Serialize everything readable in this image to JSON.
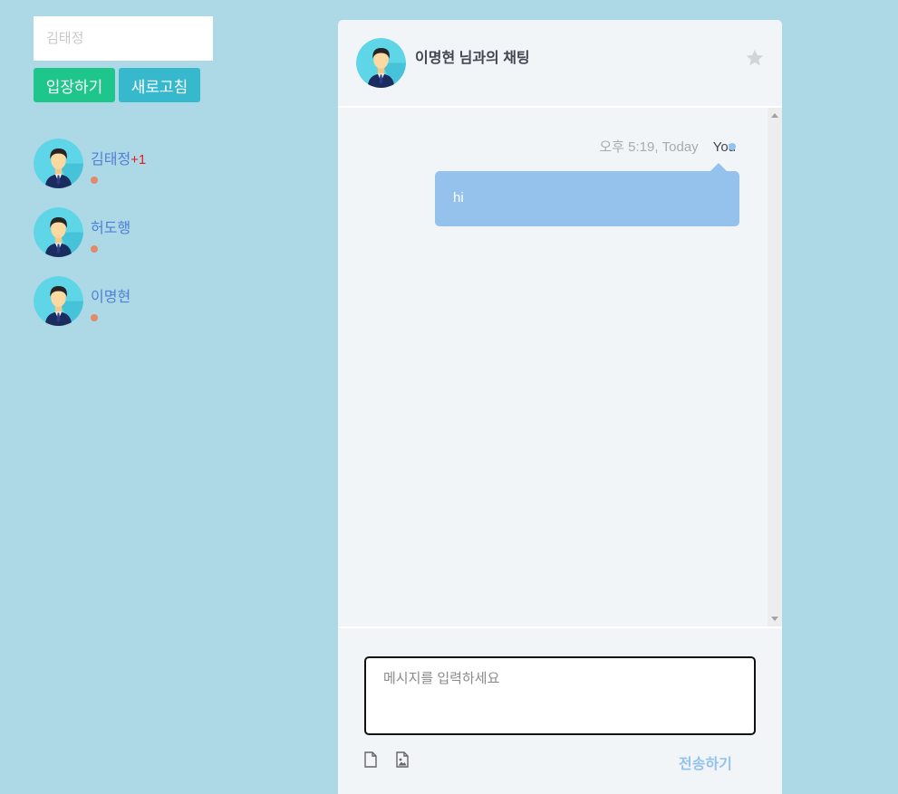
{
  "login": {
    "name_placeholder": "김태정",
    "enter_label": "입장하기",
    "refresh_label": "새로고침"
  },
  "users": [
    {
      "name": "김태정",
      "badge": "+1",
      "status_color": "#e38968"
    },
    {
      "name": "허도행",
      "badge": "",
      "status_color": "#e38968"
    },
    {
      "name": "이명현",
      "badge": "",
      "status_color": "#e38968"
    }
  ],
  "chat": {
    "title": "이명현 님과의 채팅",
    "messages": [
      {
        "time": "오후 5:19, Today",
        "author": "You",
        "text": "hi"
      }
    ],
    "input_placeholder": "메시지를 입력하세요",
    "send_label": "전송하기"
  },
  "icons": {
    "avatar": "user-avatar-icon",
    "star": "star-icon",
    "file": "file-icon",
    "image": "image-icon"
  },
  "colors": {
    "background": "#add8e6",
    "enter_button": "#1fc68b",
    "refresh_button": "#36b9cc",
    "bubble": "#94c2ed",
    "status_offline": "#e38968",
    "badge": "#e51c1c"
  }
}
